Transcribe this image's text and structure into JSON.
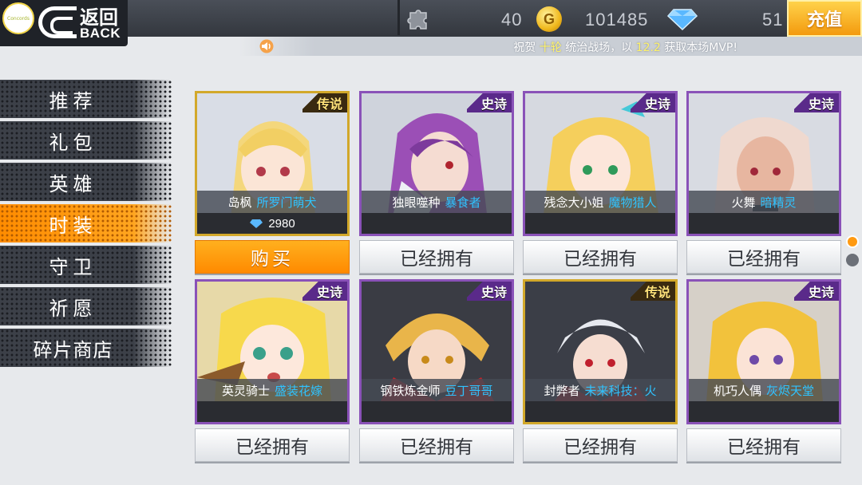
{
  "header": {
    "logo_text": "Concords",
    "back_label_cn": "返回",
    "back_label_en": "BACK",
    "puzzle_count": "40",
    "coin_count": "101485",
    "gem_count": "51",
    "recharge_label": "充值"
  },
  "announcement": {
    "prefix": "祝贺 ",
    "player": "十轮",
    "middle": " 统治战场，以 ",
    "score": "12.2",
    "suffix": " 获取本场MVP!"
  },
  "nav": {
    "items": [
      {
        "label": "推荐"
      },
      {
        "label": "礼包"
      },
      {
        "label": "英雄"
      },
      {
        "label": "时装"
      },
      {
        "label": "守卫"
      },
      {
        "label": "祈愿"
      },
      {
        "label": "碎片商店"
      }
    ],
    "active_index": 3
  },
  "cards": [
    {
      "rarity": "传说",
      "character": "岛枫",
      "skin": "所罗门萌犬",
      "price": "2980",
      "button": "购买"
    },
    {
      "rarity": "史诗",
      "character": "独眼噬种",
      "skin": "暴食者",
      "price": "",
      "button": "已经拥有"
    },
    {
      "rarity": "史诗",
      "character": "残念大小姐",
      "skin": "魔物猎人",
      "price": "",
      "button": "已经拥有"
    },
    {
      "rarity": "史诗",
      "character": "火舞",
      "skin": "暗精灵",
      "price": "",
      "button": "已经拥有"
    },
    {
      "rarity": "史诗",
      "character": "英灵骑士",
      "skin": "盛装花嫁",
      "price": "",
      "button": "已经拥有"
    },
    {
      "rarity": "史诗",
      "character": "钢铁炼金师",
      "skin": "豆丁哥哥",
      "price": "",
      "button": "已经拥有"
    },
    {
      "rarity": "传说",
      "character": "封弊者",
      "skin": "未来科技：火",
      "price": "",
      "button": "已经拥有"
    },
    {
      "rarity": "史诗",
      "character": "机巧人偶",
      "skin": "灰烬天堂",
      "price": "",
      "button": "已经拥有"
    }
  ],
  "colors": {
    "epic_border": "#8a52b8",
    "legend_border": "#d2a82a",
    "skin_name": "#2fc3ff",
    "active_nav": "#ff9a12",
    "buy_button": "#ff8a00"
  },
  "pager": {
    "page_count": 2,
    "current_page": 1
  }
}
